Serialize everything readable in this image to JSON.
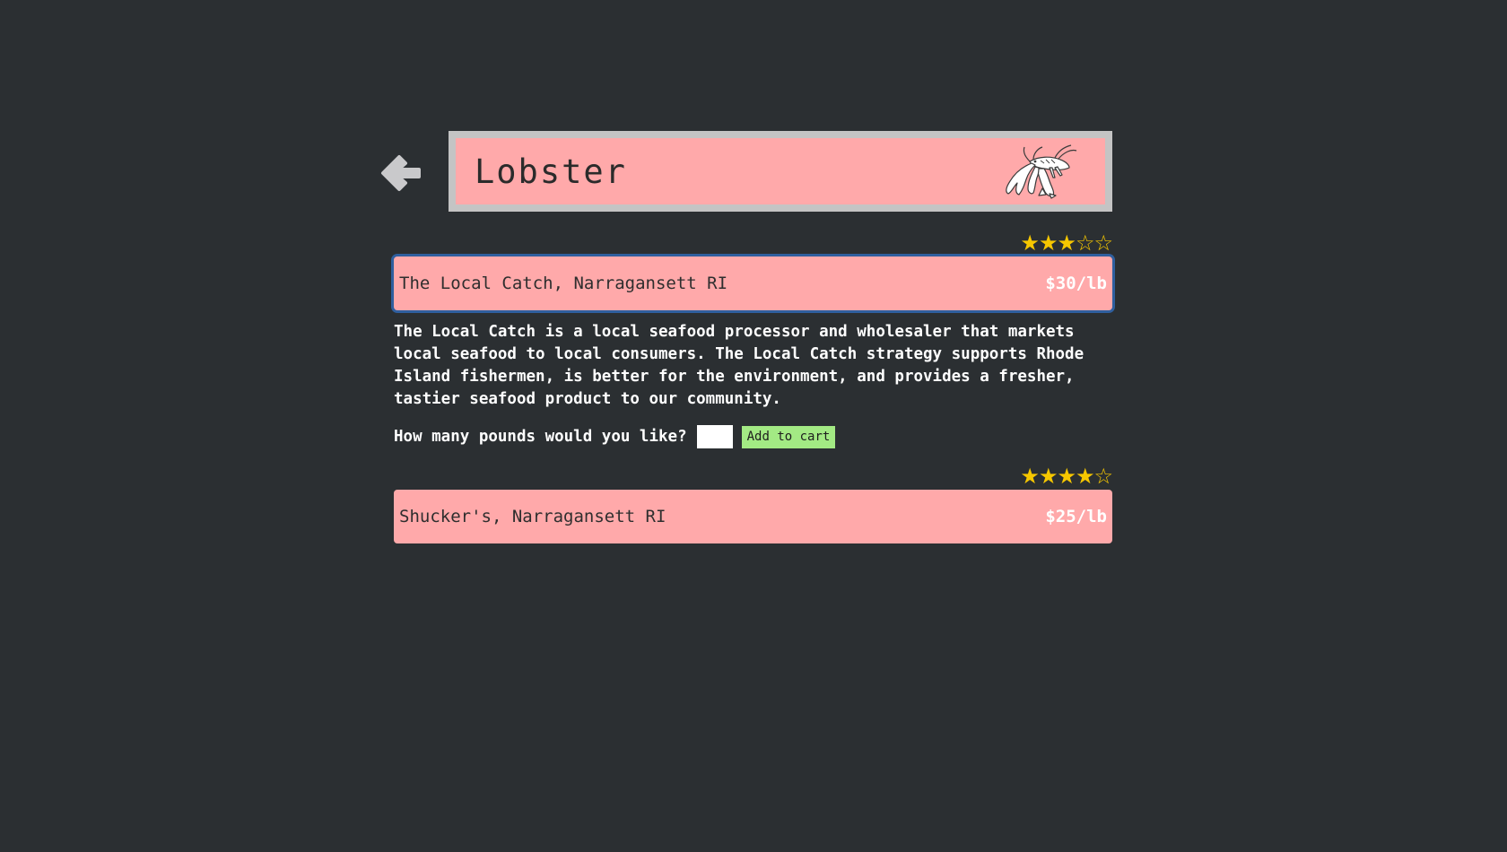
{
  "header": {
    "title": "Lobster",
    "back_icon": "left-arrow-icon",
    "product_icon": "lobster-icon"
  },
  "colors": {
    "background": "#2b2f32",
    "card": "#ffa9aa",
    "frame": "#c4c4c4",
    "star": "#f6c700",
    "button": "#a3ea84",
    "selected_outline": "#2f5f9e"
  },
  "vendors": [
    {
      "name": "The Local Catch, Narragansett RI",
      "price": "$30/lb",
      "rating": 3,
      "rating_max": 5,
      "stars": "★★★☆☆",
      "selected": true,
      "description": "The Local Catch is a local seafood processor and wholesaler that markets local seafood to local consumers. The Local Catch strategy supports Rhode Island fishermen, is better for the environment, and provides a fresher, tastier seafood product to our community.",
      "order": {
        "label": "How many pounds would you like?",
        "quantity_value": "",
        "button_label": "Add to cart"
      }
    },
    {
      "name": "Shucker's, Narragansett RI",
      "price": "$25/lb",
      "rating": 4,
      "rating_max": 5,
      "stars": "★★★★☆",
      "selected": false
    }
  ]
}
